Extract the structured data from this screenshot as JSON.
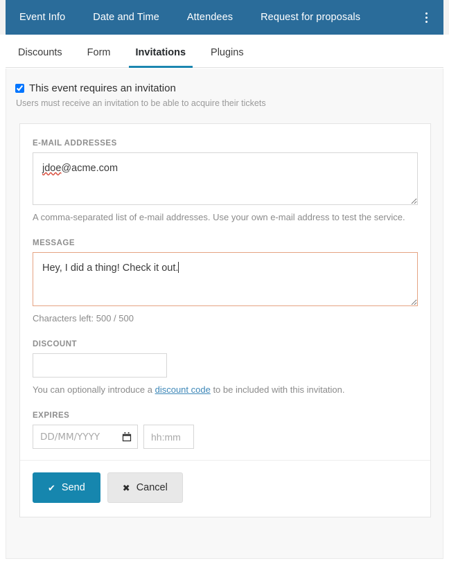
{
  "topnav": {
    "items": [
      {
        "label": "Event Info"
      },
      {
        "label": "Date and Time"
      },
      {
        "label": "Attendees"
      },
      {
        "label": "Request for proposals"
      }
    ],
    "menu_icon": "kebab-menu-icon"
  },
  "subtabs": [
    {
      "label": "Discounts",
      "active": false
    },
    {
      "label": "Form",
      "active": false
    },
    {
      "label": "Invitations",
      "active": true
    },
    {
      "label": "Plugins",
      "active": false
    }
  ],
  "require_invitation": {
    "checked": true,
    "label": "This event requires an invitation",
    "help": "Users must receive an invitation to be able to acquire their tickets"
  },
  "form": {
    "email": {
      "label": "E-MAIL ADDRESSES",
      "value": "jdoe@acme.com",
      "misspelled_part": "jdoe",
      "rest_part": "@acme.com",
      "placeholder": "",
      "help": "A comma-separated list of e-mail addresses. Use your own e-mail address to test the service."
    },
    "message": {
      "label": "MESSAGE",
      "value": "Hey, I did a thing! Check it out.",
      "placeholder": "",
      "focused_border_color": "#e5a382",
      "counter": "Characters left: 500 / 500"
    },
    "discount": {
      "label": "DISCOUNT",
      "value": "",
      "placeholder": "",
      "help_before": "You can optionally introduce a ",
      "help_link": "discount code",
      "help_after": " to be included with this invitation."
    },
    "expires": {
      "label": "EXPIRES",
      "date_value": "",
      "date_placeholder": "DD/MM/YYYY",
      "time_value": "",
      "time_placeholder": "hh:mm",
      "calendar_icon": "calendar-icon"
    }
  },
  "footer": {
    "send_label": "Send",
    "send_icon": "check-icon",
    "cancel_label": "Cancel",
    "cancel_icon": "close-x-icon"
  },
  "colors": {
    "topnav_bg": "#2a6c9a",
    "accent": "#1b86b0",
    "primary_button": "#1686ae",
    "link": "#3d87b8",
    "focus_border": "#e5a382",
    "page_bg": "#f8f8f8"
  }
}
